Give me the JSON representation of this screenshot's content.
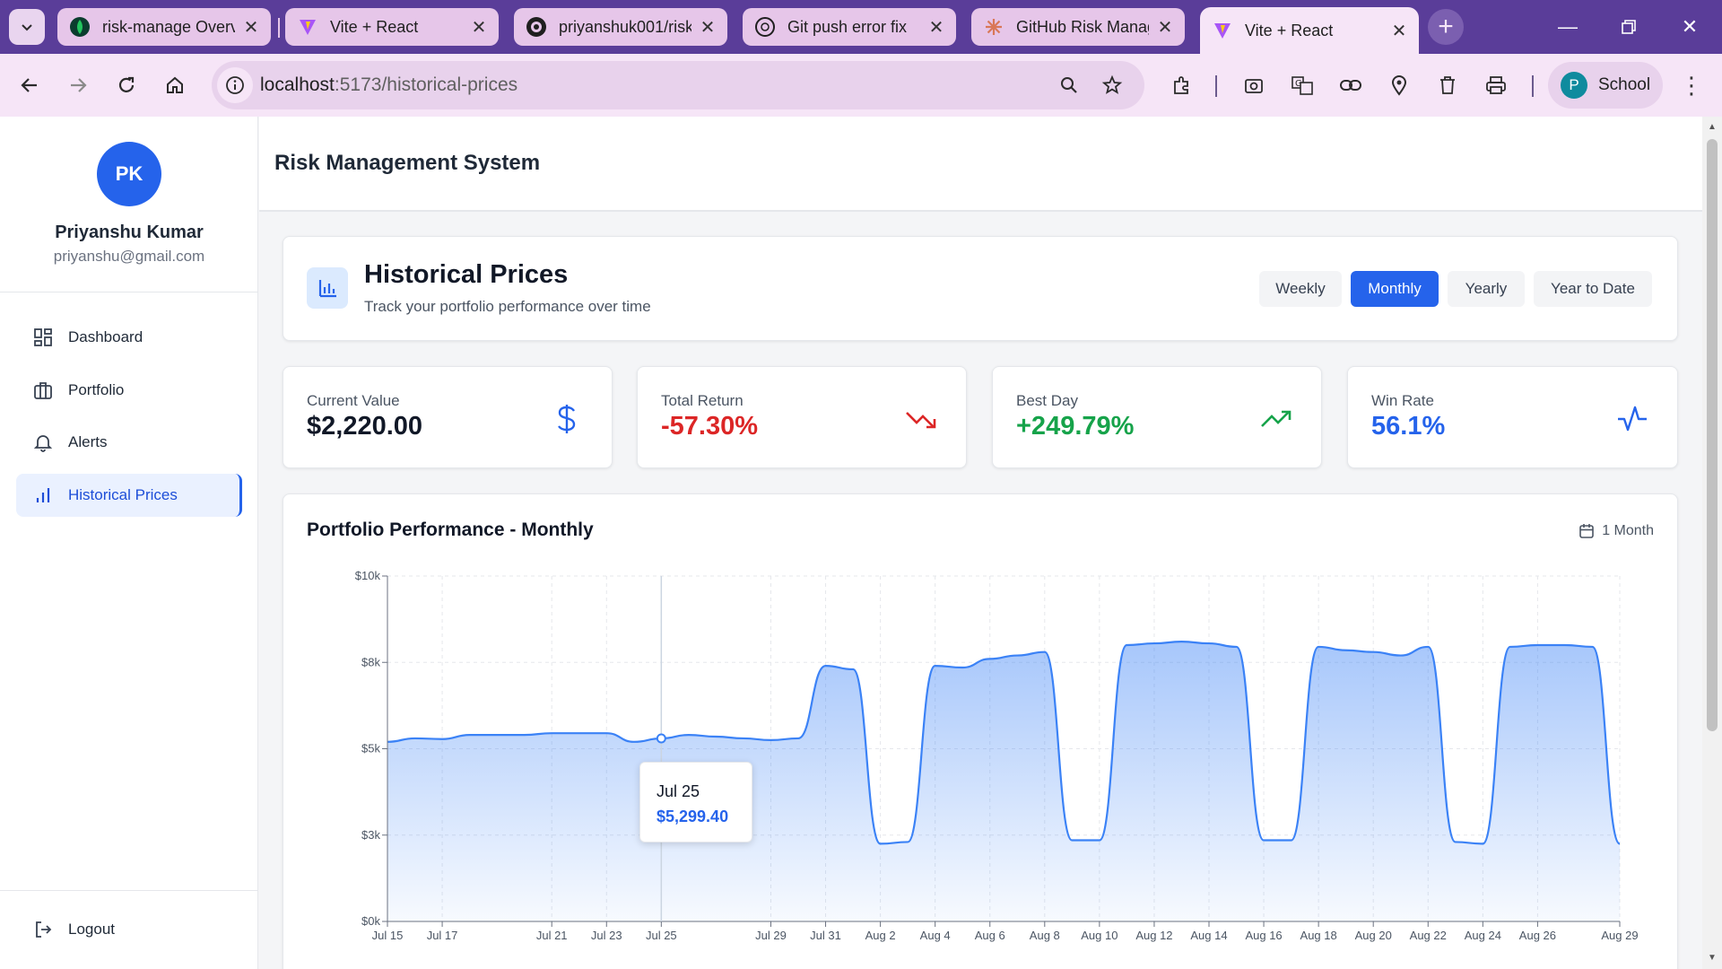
{
  "browser": {
    "tabs": [
      {
        "title": "risk-manage Overv",
        "icon": "mongodb-leaf-icon"
      },
      {
        "title": "Vite + React",
        "icon": "vite-icon"
      },
      {
        "title": "priyanshuk001/risk",
        "icon": "github-icon"
      },
      {
        "title": "Git push error fix",
        "icon": "openai-icon"
      },
      {
        "title": "GitHub Risk Manag",
        "icon": "claude-icon"
      },
      {
        "title": "Vite + React",
        "icon": "vite-icon",
        "active": true
      }
    ],
    "url_host": "localhost",
    "url_path": ":5173/historical-prices",
    "profile_initial": "P",
    "profile_name": "School",
    "accent": "#5a3d99"
  },
  "sidebar": {
    "avatar_initials": "PK",
    "user_name": "Priyanshu Kumar",
    "user_email": "priyanshu@gmail.com",
    "items": [
      {
        "label": "Dashboard",
        "icon": "dashboard-icon"
      },
      {
        "label": "Portfolio",
        "icon": "briefcase-icon"
      },
      {
        "label": "Alerts",
        "icon": "bell-icon"
      },
      {
        "label": "Historical Prices",
        "icon": "bar-chart-icon",
        "active": true
      }
    ],
    "logout_label": "Logout"
  },
  "header": {
    "app_title": "Risk Management System"
  },
  "historical": {
    "title": "Historical Prices",
    "subtitle": "Track your portfolio performance over time",
    "periods": [
      "Weekly",
      "Monthly",
      "Yearly",
      "Year to Date"
    ],
    "active_period": "Monthly"
  },
  "stats": [
    {
      "label": "Current Value",
      "value": "$2,220.00",
      "color": "#111827",
      "icon": "dollar-icon"
    },
    {
      "label": "Total Return",
      "value": "-57.30%",
      "color": "#dc2626",
      "icon": "trending-down-icon"
    },
    {
      "label": "Best Day",
      "value": "+249.79%",
      "color": "#16a34a",
      "icon": "trending-up-icon"
    },
    {
      "label": "Win Rate",
      "value": "56.1%",
      "color": "#2563eb",
      "icon": "activity-icon"
    }
  ],
  "chart": {
    "title": "Portfolio Performance - Monthly",
    "range_label": "1 Month",
    "tooltip": {
      "date": "Jul 25",
      "value": "$5,299.40"
    }
  },
  "chart_data": {
    "type": "area",
    "title": "Portfolio Performance - Monthly",
    "y_ticks": [
      "$0k",
      "$3k",
      "$5k",
      "$8k",
      "$10k"
    ],
    "ylim": [
      0,
      10000
    ],
    "x_ticks": [
      "Jul 15",
      "Jul 17",
      "Jul 21",
      "Jul 23",
      "Jul 25",
      "Jul 29",
      "Jul 31",
      "Aug 2",
      "Aug 4",
      "Aug 6",
      "Aug 8",
      "Aug 10",
      "Aug 12",
      "Aug 14",
      "Aug 16",
      "Aug 18",
      "Aug 20",
      "Aug 22",
      "Aug 24",
      "Aug 26",
      "Aug 29"
    ],
    "grid": true,
    "series": [
      {
        "color": "#3b82f6",
        "x": [
          "Jul 15",
          "Jul 16",
          "Jul 17",
          "Jul 18",
          "Jul 19",
          "Jul 20",
          "Jul 21",
          "Jul 22",
          "Jul 23",
          "Jul 24",
          "Jul 25",
          "Jul 26",
          "Jul 27",
          "Jul 28",
          "Jul 29",
          "Jul 30",
          "Jul 31",
          "Aug 1",
          "Aug 2",
          "Aug 3",
          "Aug 4",
          "Aug 5",
          "Aug 6",
          "Aug 7",
          "Aug 8",
          "Aug 9",
          "Aug 10",
          "Aug 11",
          "Aug 12",
          "Aug 13",
          "Aug 14",
          "Aug 15",
          "Aug 16",
          "Aug 17",
          "Aug 18",
          "Aug 19",
          "Aug 20",
          "Aug 21",
          "Aug 22",
          "Aug 23",
          "Aug 24",
          "Aug 25",
          "Aug 26",
          "Aug 27",
          "Aug 28",
          "Aug 29"
        ],
        "values": [
          5200,
          5300,
          5280,
          5400,
          5400,
          5400,
          5450,
          5450,
          5450,
          5200,
          5299.4,
          5400,
          5350,
          5300,
          5250,
          5300,
          7400,
          7300,
          2250,
          2300,
          7400,
          7350,
          7600,
          7700,
          7800,
          2350,
          2350,
          8000,
          8050,
          8100,
          8050,
          7950,
          2350,
          2350,
          7950,
          7850,
          7800,
          7700,
          7950,
          2300,
          2250,
          7950,
          8000,
          8000,
          7950,
          2250
        ]
      }
    ]
  }
}
